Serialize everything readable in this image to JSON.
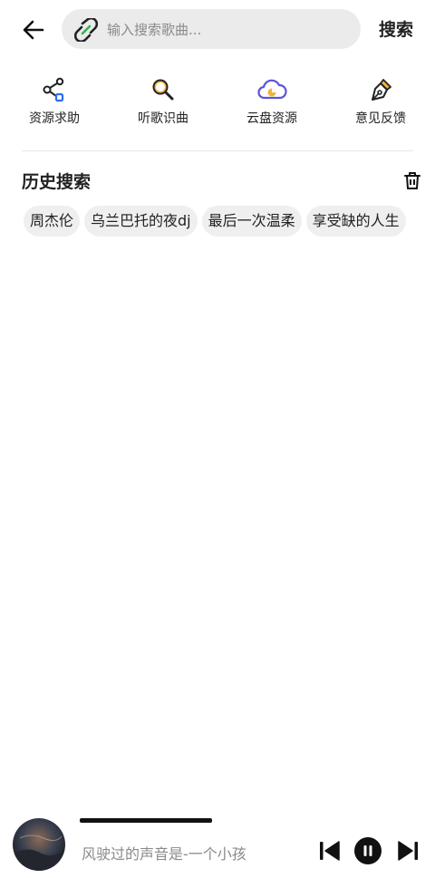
{
  "header": {
    "search_placeholder": "输入搜索歌曲...",
    "search_button": "搜索"
  },
  "quick_actions": [
    {
      "label": "资源求助",
      "icon": "share-nodes-icon"
    },
    {
      "label": "听歌识曲",
      "icon": "magnifier-icon"
    },
    {
      "label": "云盘资源",
      "icon": "cloud-icon"
    },
    {
      "label": "意见反馈",
      "icon": "pen-nib-icon"
    }
  ],
  "history": {
    "title": "历史搜索",
    "tags": [
      "周杰伦",
      "乌兰巴托的夜dj",
      "最后一次温柔",
      "享受缺的人生"
    ]
  },
  "player": {
    "title": "风驶过的声音是-一个小孩",
    "progress": 0.3
  },
  "colors": {
    "accent_blue": "#2a6ef0",
    "accent_yellow": "#f3b23a",
    "accent_green": "#2fb54a",
    "cloud_purple": "#5b55d6"
  }
}
